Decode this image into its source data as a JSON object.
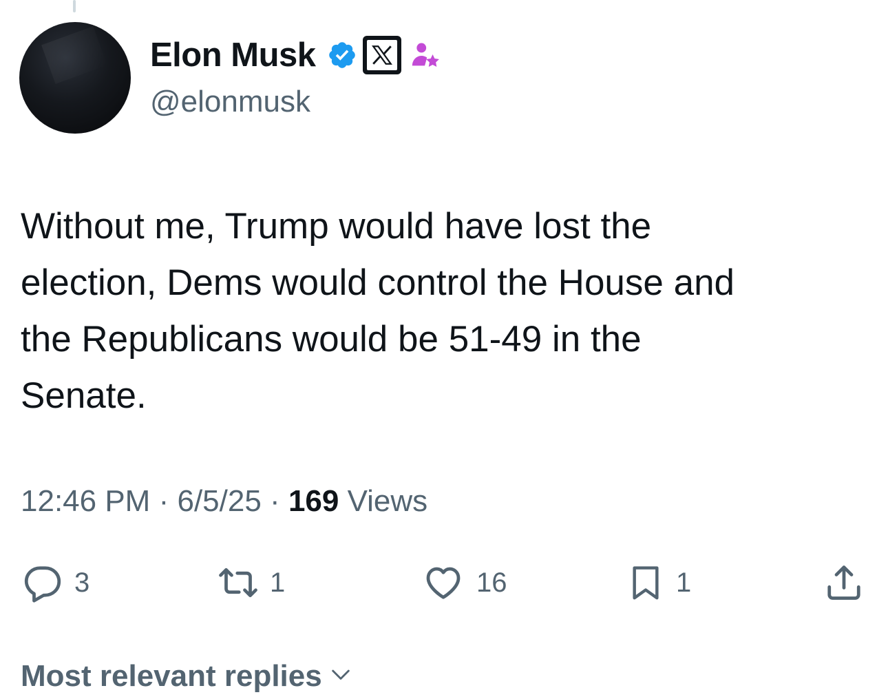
{
  "author": {
    "display_name": "Elon Musk",
    "handle": "@elonmusk",
    "badges": [
      "verified-badge-icon",
      "x-affiliate-badge-icon",
      "person-star-icon"
    ],
    "verified_color": "#1d9bf0",
    "affiliate_icon_color": "#c34bd6"
  },
  "tweet": {
    "text": "Without me, Trump would have lost the\nelection, Dems would control the House and\nthe Republicans would be 51-49 in the\nSenate.",
    "time": "12:46 PM",
    "sep1": "·",
    "date": "6/5/25",
    "sep2": "·",
    "views_count": "169",
    "views_label": "Views"
  },
  "actions": {
    "reply": {
      "icon": "reply-icon",
      "count": "3"
    },
    "repost": {
      "icon": "repost-icon",
      "count": "1"
    },
    "like": {
      "icon": "heart-icon",
      "count": "16"
    },
    "bookmark": {
      "icon": "bookmark-icon",
      "count": "1"
    },
    "share": {
      "icon": "share-icon"
    }
  },
  "replies_sort": {
    "label": "Most relevant replies",
    "icon": "chevron-down-icon"
  },
  "colors": {
    "text_primary": "#0f1419",
    "text_secondary": "#536471",
    "background": "#ffffff"
  }
}
